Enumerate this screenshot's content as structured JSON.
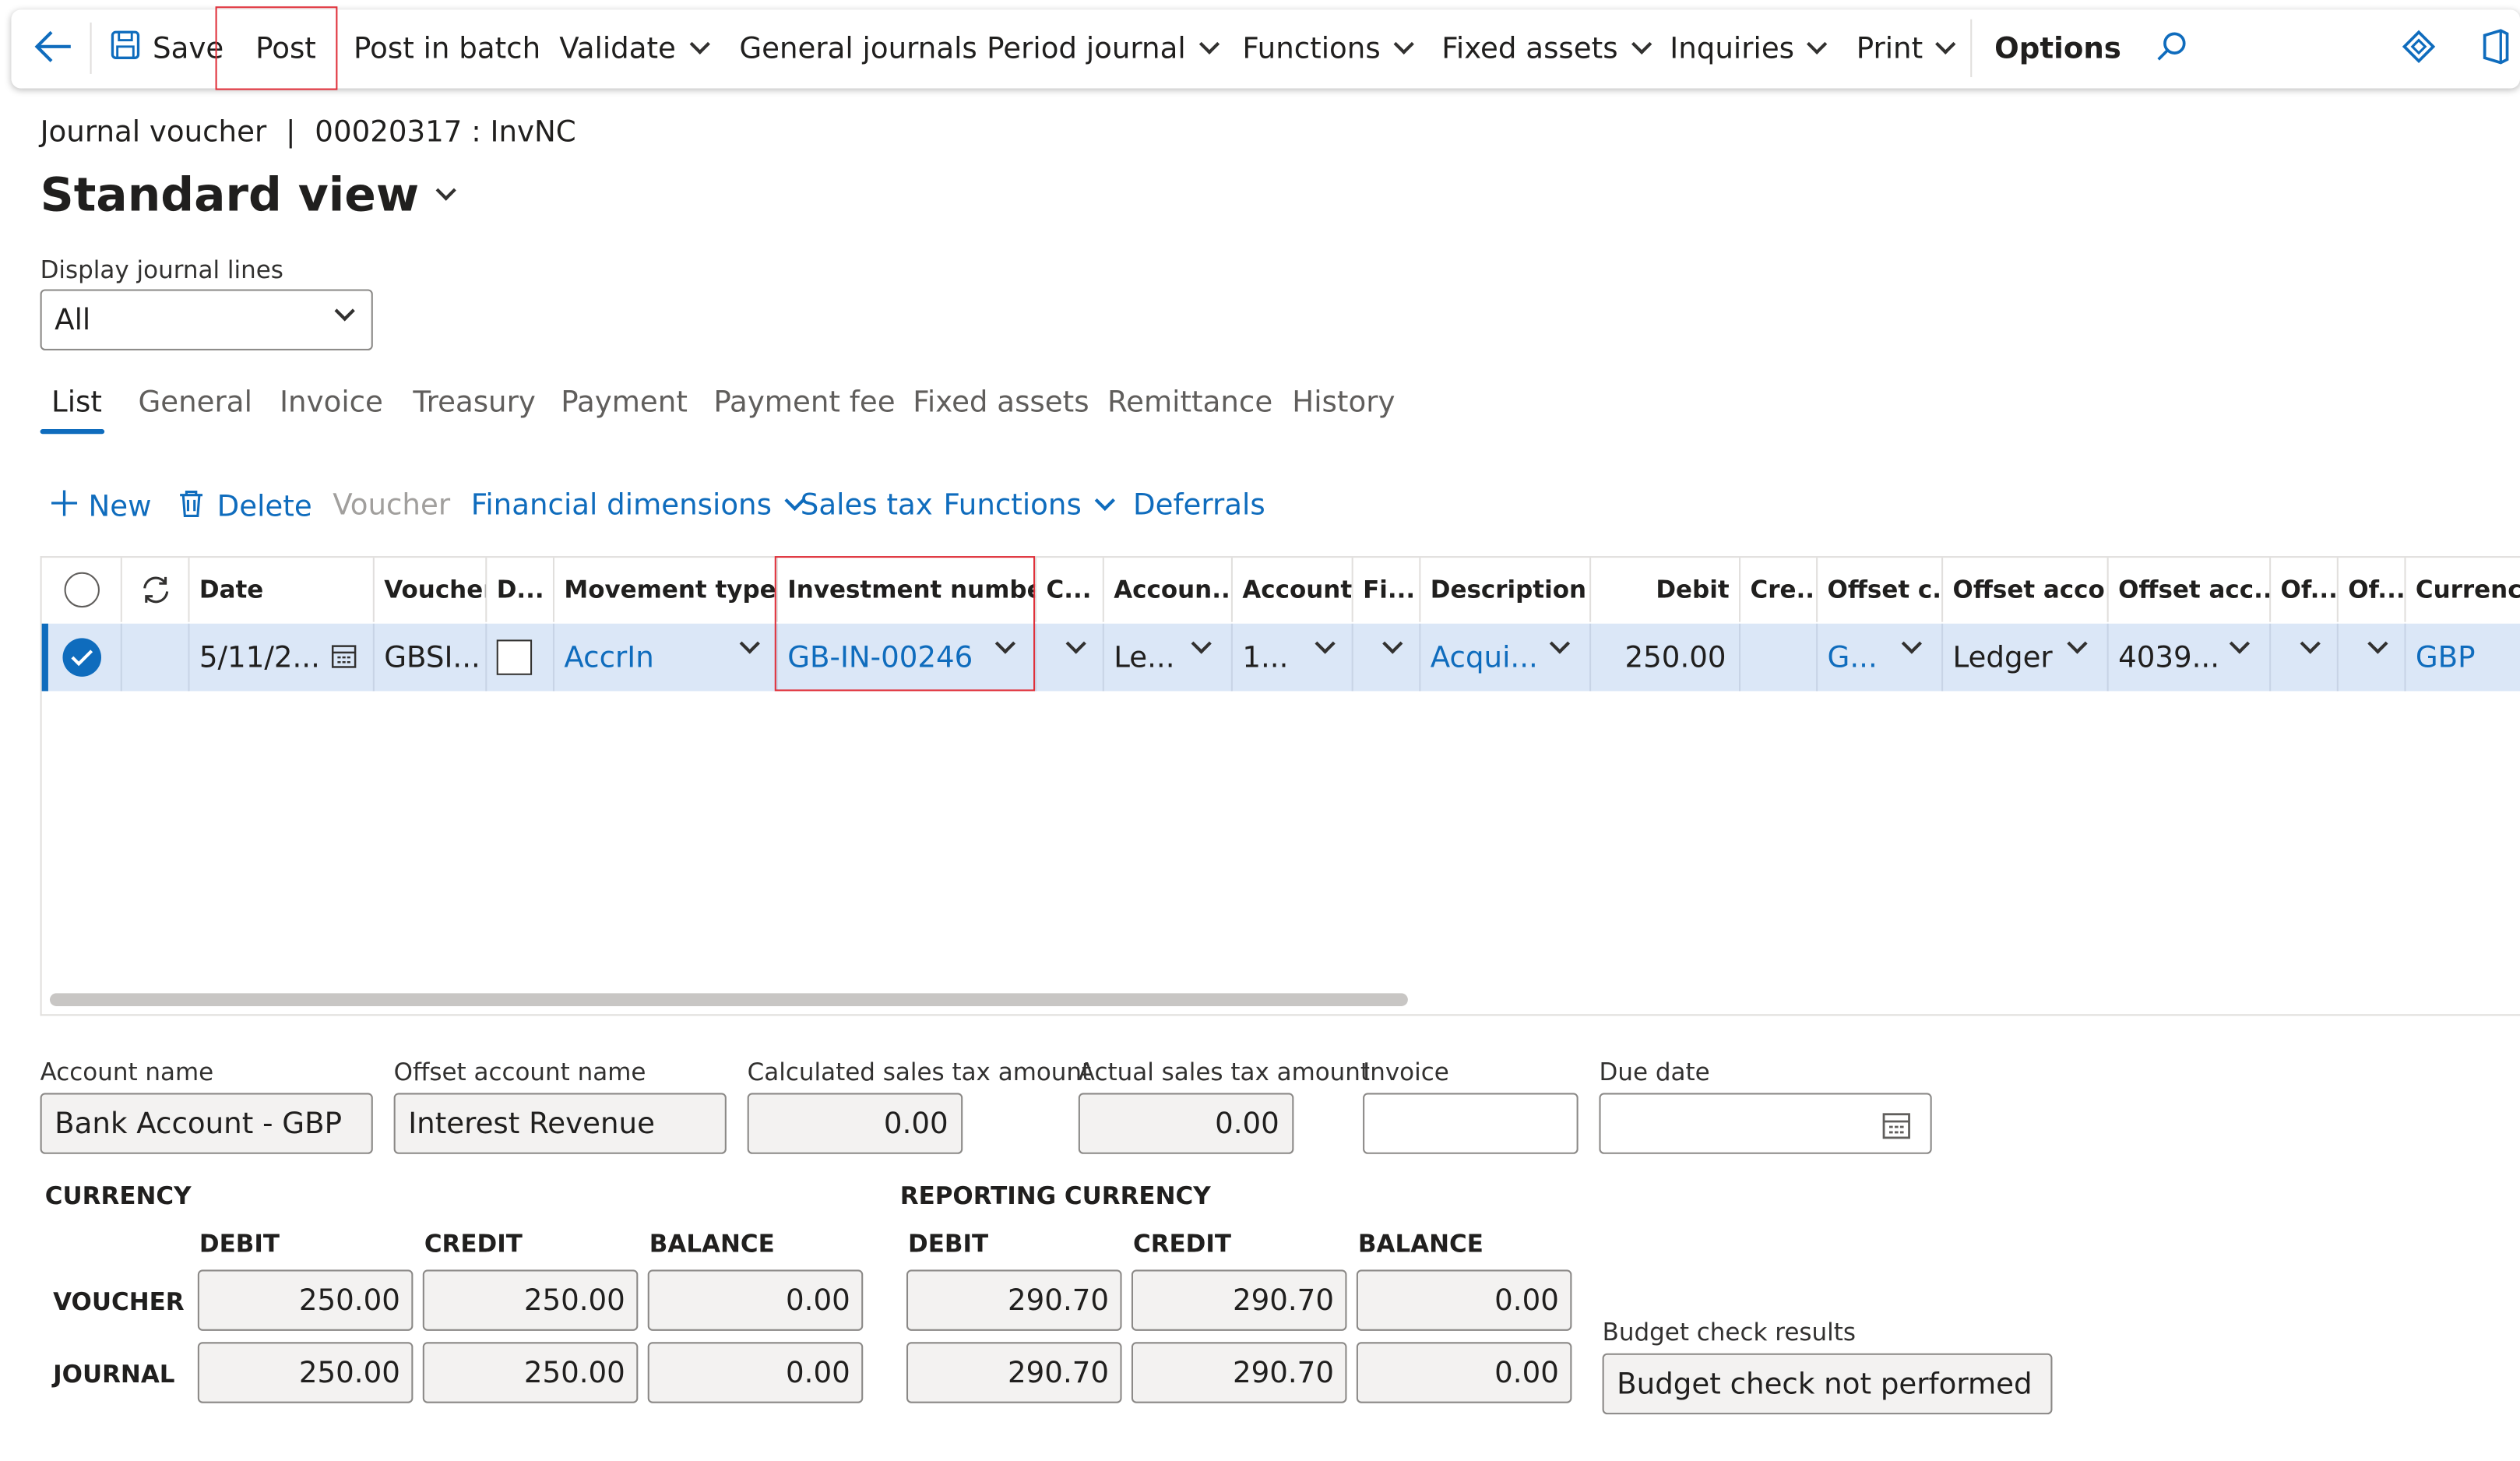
{
  "actionbar": {
    "save": "Save",
    "post": "Post",
    "post_batch": "Post in batch",
    "validate": "Validate",
    "general_journals": "General journals",
    "period_journal": "Period journal",
    "functions": "Functions",
    "fixed_assets": "Fixed assets",
    "inquiries": "Inquiries",
    "print": "Print",
    "options": "Options"
  },
  "header": {
    "breadcrumb_left": "Journal voucher",
    "breadcrumb_sep": "|",
    "breadcrumb_right": "00020317 : InvNC",
    "view_title": "Standard view"
  },
  "display_lines": {
    "label": "Display journal lines",
    "value": "All"
  },
  "tabs": [
    "List",
    "General",
    "Invoice",
    "Treasury",
    "Payment",
    "Payment fee",
    "Fixed assets",
    "Remittance",
    "History"
  ],
  "toolbar": {
    "new": "New",
    "delete": "Delete",
    "voucher": "Voucher",
    "financial_dimensions": "Financial dimensions",
    "sales_tax": "Sales tax",
    "functions": "Functions",
    "deferrals": "Deferrals"
  },
  "grid": {
    "columns": [
      "Date",
      "Voucher",
      "D...",
      "Movement type",
      "Investment number",
      "C...",
      "Accoun...",
      "Account",
      "Fi...",
      "Description",
      "Debit",
      "Cre...",
      "Offset c...",
      "Offset acco...",
      "Offset acc...",
      "Of...",
      "Of...",
      "Currency"
    ],
    "row": {
      "date": "5/11/2...",
      "voucher": "GBSI...",
      "movement_type": "AccrIn",
      "investment_number": "GB-IN-00246",
      "account_type": "Le...",
      "account": "1...",
      "description": "Acqui...",
      "debit": "250.00",
      "offset_company": "G...",
      "offset_account_type": "Ledger",
      "offset_account": "4039...",
      "currency": "GBP"
    }
  },
  "fields": {
    "account_name_label": "Account name",
    "account_name": "Bank Account - GBP",
    "offset_name_label": "Offset account name",
    "offset_name": "Interest Revenue",
    "calc_tax_label": "Calculated sales tax amount",
    "calc_tax": "0.00",
    "actual_tax_label": "Actual sales tax amount",
    "actual_tax": "0.00",
    "invoice_label": "Invoice",
    "invoice": "",
    "due_date_label": "Due date",
    "due_date": ""
  },
  "currency": {
    "title": "CURRENCY",
    "debit": "DEBIT",
    "credit": "CREDIT",
    "balance": "BALANCE",
    "voucher_label": "VOUCHER",
    "journal_label": "JOURNAL",
    "voucher_debit": "250.00",
    "voucher_credit": "250.00",
    "voucher_balance": "0.00",
    "journal_debit": "250.00",
    "journal_credit": "250.00",
    "journal_balance": "0.00"
  },
  "reporting": {
    "title": "REPORTING CURRENCY",
    "debit": "DEBIT",
    "credit": "CREDIT",
    "balance": "BALANCE",
    "voucher_debit": "290.70",
    "voucher_credit": "290.70",
    "voucher_balance": "0.00",
    "journal_debit": "290.70",
    "journal_credit": "290.70",
    "journal_balance": "0.00"
  },
  "budget": {
    "label": "Budget check results",
    "value": "Budget check not performed"
  },
  "colors": {
    "accent": "#0f6cbd",
    "highlight": "#e0303a",
    "row_selected": "#dbe7f7"
  }
}
